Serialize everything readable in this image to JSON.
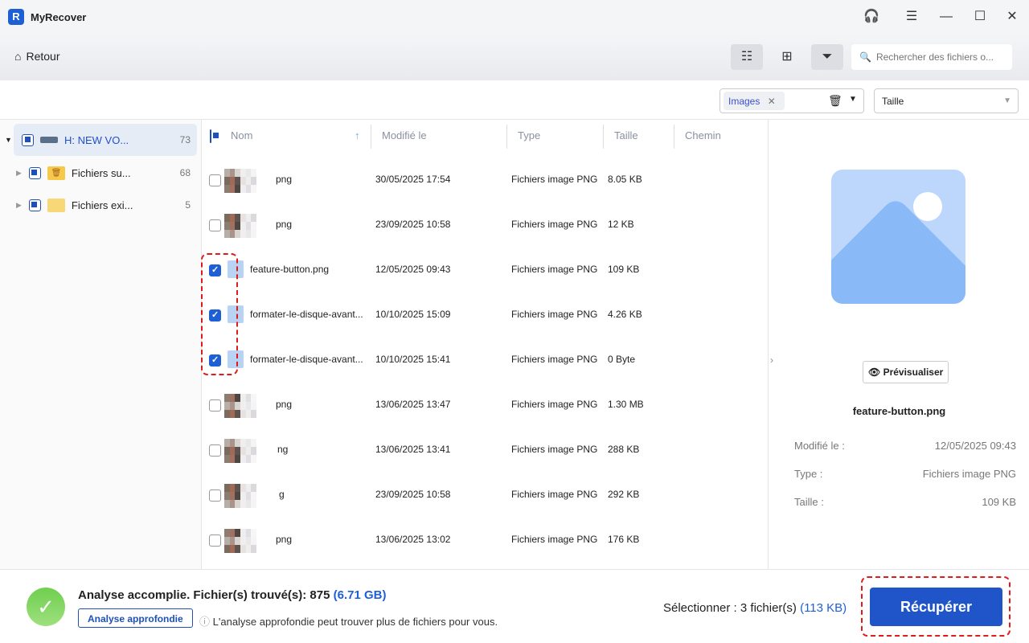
{
  "app": {
    "title": "MyRecover",
    "logo": "R"
  },
  "toolbar": {
    "back_label": "Retour",
    "search_placeholder": "Rechercher des fichiers o..."
  },
  "filters": {
    "type_chip": "Images",
    "size_label": "Taille"
  },
  "sidebar": {
    "items": [
      {
        "label": "H: NEW VO...",
        "count": "73"
      },
      {
        "label": "Fichiers su...",
        "count": "68"
      },
      {
        "label": "Fichiers exi...",
        "count": "5"
      }
    ]
  },
  "columns": [
    "Nom",
    "Modifié le",
    "Type",
    "Taille",
    "Chemin"
  ],
  "rows": [
    {
      "name": "png",
      "date": "30/05/2025 17:54",
      "type": "Fichiers image PNG",
      "size": "8.05 KB",
      "checked": false,
      "blur": true
    },
    {
      "name": "png",
      "date": "23/09/2025 10:58",
      "type": "Fichiers image PNG",
      "size": "12 KB",
      "checked": false,
      "blur": true
    },
    {
      "name": "feature-button.png",
      "date": "12/05/2025 09:43",
      "type": "Fichiers image PNG",
      "size": "109 KB",
      "checked": true,
      "blur": false
    },
    {
      "name": "formater-le-disque-avant...",
      "date": "10/10/2025 15:09",
      "type": "Fichiers image PNG",
      "size": "4.26 KB",
      "checked": true,
      "blur": false
    },
    {
      "name": "formater-le-disque-avant...",
      "date": "10/10/2025 15:41",
      "type": "Fichiers image PNG",
      "size": "0 Byte",
      "checked": true,
      "blur": false
    },
    {
      "name": "png",
      "date": "13/06/2025 13:47",
      "type": "Fichiers image PNG",
      "size": "1.30 MB",
      "checked": false,
      "blur": true
    },
    {
      "name": "ng",
      "date": "13/06/2025 13:41",
      "type": "Fichiers image PNG",
      "size": "288 KB",
      "checked": false,
      "blur": true
    },
    {
      "name": "g",
      "date": "23/09/2025 10:58",
      "type": "Fichiers image PNG",
      "size": "292 KB",
      "checked": false,
      "blur": true
    },
    {
      "name": "png",
      "date": "13/06/2025 13:02",
      "type": "Fichiers image PNG",
      "size": "176 KB",
      "checked": false,
      "blur": true
    }
  ],
  "preview": {
    "button": "Prévisualiser",
    "filename": "feature-button.png",
    "fields": [
      {
        "k": "Modifié le :",
        "v": "12/05/2025 09:43"
      },
      {
        "k": "Type :",
        "v": "Fichiers image PNG"
      },
      {
        "k": "Taille :",
        "v": "109 KB"
      }
    ]
  },
  "footer": {
    "status": "Analyse accomplie. Fichier(s) trouvé(s): 875",
    "status_size": "(6.71 GB)",
    "deep_scan": "Analyse approfondie",
    "hint": "L'analyse approfondie peut trouver plus de fichiers pour vous.",
    "selected": "Sélectionner : 3 fichier(s)",
    "selected_size": "(113 KB)",
    "recover": "Récupérer"
  }
}
